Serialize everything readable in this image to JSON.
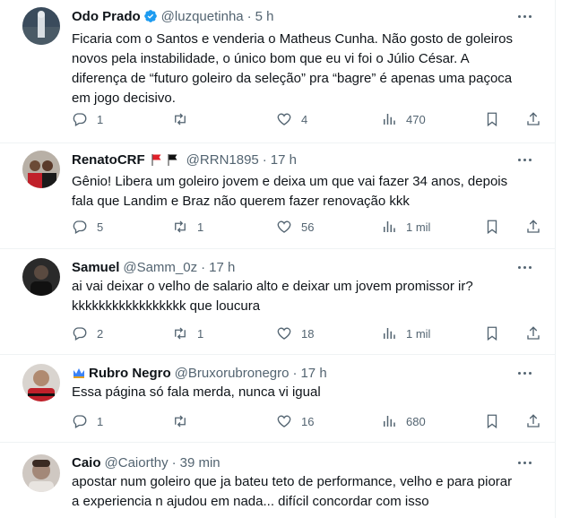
{
  "tweets": [
    {
      "name": "Odo Prado",
      "verified": true,
      "handle": "@luzquetinha",
      "time": "5 h",
      "text": "Ficaria com o Santos e venderia o Matheus Cunha. Não gosto de goleiros\nnovos pela instabilidade, o único bom que eu vi foi o Júlio César. A\ndiferença de “futuro goleiro da seleção” pra “bagre” é apenas uma paçoca\nem jogo decisivo.",
      "replies": "1",
      "retweets": "",
      "likes": "4",
      "views": "470",
      "avatar_color": "#2b3a4a"
    },
    {
      "name": "RenatoCRF",
      "flags": [
        "red-flag-icon",
        "black-flag-icon"
      ],
      "handle": "@RRN1895",
      "time": "17 h",
      "text": "Gênio! Libera um goleiro jovem e deixa um que vai fazer 34 anos, depois\nfala que Landim e Braz não querem fazer renovação kkk",
      "replies": "5",
      "retweets": "1",
      "likes": "56",
      "views": "1 mil",
      "avatar_color": "#8b2a2a"
    },
    {
      "name": "Samuel",
      "handle": "@Samm_0z",
      "time": "17 h",
      "text": "ai vai deixar o velho de salario alto e deixar um jovem promissor ir?\nkkkkkkkkkkkkkkkkk que loucura",
      "replies": "2",
      "retweets": "1",
      "likes": "18",
      "views": "1 mil",
      "avatar_color": "#1c1c1c"
    },
    {
      "name": "Rubro Negro",
      "handle": "@Bruxorubronegro",
      "time": "17 h",
      "text": "Essa página só fala merda, nunca vi igual",
      "replies": "1",
      "retweets": "",
      "likes": "16",
      "views": "680",
      "avatar_color": "#7a6a5a"
    },
    {
      "name": "Caio",
      "handle": "@Caiorthy",
      "time": "39 min",
      "text": "apostar num goleiro que ja bateu teto de performance, velho e para piorar\na experiencia n ajudou em nada... difícil concordar com isso",
      "avatar_color": "#9a8f86"
    }
  ],
  "colors": {
    "text": "#0f1419",
    "muted": "#536471",
    "verified": "#1d9bf0",
    "divider": "#eff3f4"
  }
}
